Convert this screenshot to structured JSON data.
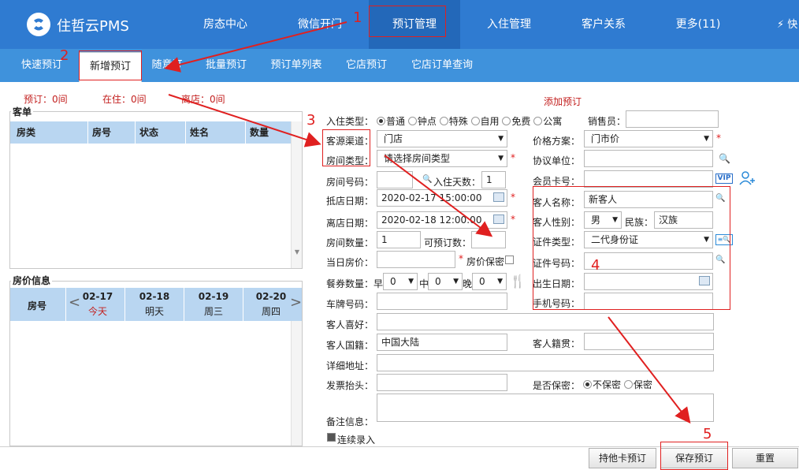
{
  "app": {
    "logo_text": "住哲云PMS"
  },
  "top_nav": [
    "房态中心",
    "微信开门",
    "预订管理",
    "入住管理",
    "客户关系",
    "更多(11)"
  ],
  "quick": "⚡ 快",
  "sub_nav": [
    "快速预订",
    "新增预订",
    "随意订",
    "批量预订",
    "预订单列表",
    "它店预订",
    "它店订单查询"
  ],
  "stats": {
    "reserved": "预订：0间",
    "in_house": "在住：0间",
    "departing": "离店：0间"
  },
  "add_title": "添加预订",
  "order_panel": {
    "title": "客单",
    "cols": [
      "房类",
      "房号",
      "状态",
      "姓名",
      "数量"
    ]
  },
  "price_panel": {
    "title": "房价信息",
    "room_col": "房号",
    "days": [
      {
        "date": "02-17",
        "label": "今天"
      },
      {
        "date": "02-18",
        "label": "明天"
      },
      {
        "date": "02-19",
        "label": "周三"
      },
      {
        "date": "02-20",
        "label": "周四"
      }
    ]
  },
  "form": {
    "checkin_type": {
      "label": "入住类型：",
      "options": [
        "普通",
        "钟点",
        "特殊",
        "自用",
        "免费",
        "公寓"
      ]
    },
    "salesperson": "销售员：",
    "channel": {
      "label": "客源渠道：",
      "value": "门店"
    },
    "price_plan": {
      "label": "价格方案：",
      "value": "门市价"
    },
    "room_type": {
      "label": "房间类型：",
      "value": "请选择房间类型"
    },
    "agreement_unit": "协议单位：",
    "room_no": "房间号码：",
    "days": {
      "label": "入住天数：",
      "value": "1"
    },
    "member_card": "会员卡号：",
    "vip": "VIP",
    "arrive": {
      "label": "抵店日期：",
      "value": "2020-02-17 15:00:00"
    },
    "depart": {
      "label": "离店日期：",
      "value": "2020-02-18 12:00:00"
    },
    "room_count": {
      "label": "房间数量：",
      "value": "1"
    },
    "bookable": "可预订数：",
    "day_price": "当日房价：",
    "price_secret": "房价保密",
    "meals": {
      "label": "餐券数量：",
      "breakfast": "早",
      "lunch": "中",
      "dinner": "晚",
      "values": [
        "0",
        "0",
        "0"
      ]
    },
    "plate": "车牌号码：",
    "hobby": "客人喜好：",
    "nationality": {
      "label": "客人国籍：",
      "value": "中国大陆"
    },
    "native_place": "客人籍贯：",
    "address": "详细地址：",
    "invoice": "发票抬头：",
    "confidential": {
      "label": "是否保密：",
      "options": [
        "不保密",
        "保密"
      ]
    },
    "remark": "备注信息：",
    "continuous": "连续录入",
    "guest_name": {
      "label": "客人名称：",
      "value": "新客人"
    },
    "gender": {
      "label": "客人性别：",
      "value": "男"
    },
    "ethnicity": {
      "label": "民族：",
      "value": "汉族"
    },
    "id_type": {
      "label": "证件类型：",
      "value": "二代身份证"
    },
    "id_no": "证件号码：",
    "birthday": "出生日期：",
    "phone": "手机号码："
  },
  "buttons": {
    "other_card": "持他卡预订",
    "save": "保存预订",
    "reset": "重置"
  },
  "annotations": [
    "1",
    "2",
    "3",
    "4",
    "5"
  ],
  "colors": {
    "topbar": "#2f7bd1",
    "subbar": "#3f92dc",
    "annotation": "#e02020",
    "grid_header": "#b9d6f1"
  }
}
